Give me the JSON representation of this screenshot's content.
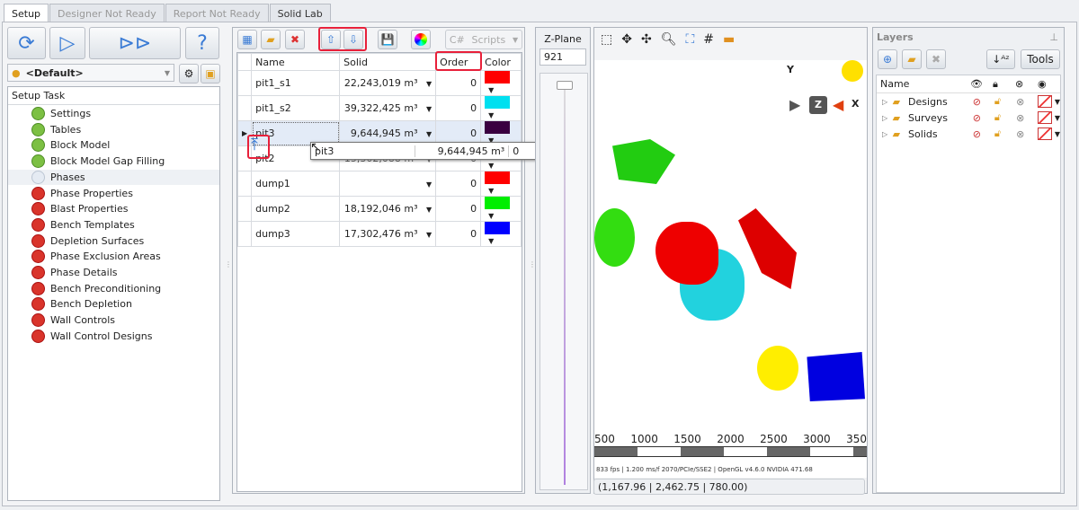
{
  "tabs": [
    "Setup",
    "Designer Not Ready",
    "Report Not Ready",
    "Solid Lab"
  ],
  "profile": "<Default>",
  "setup_task_header": "Setup Task",
  "tasks": [
    {
      "label": "Settings",
      "status": "ok"
    },
    {
      "label": "Tables",
      "status": "ok"
    },
    {
      "label": "Block Model",
      "status": "ok"
    },
    {
      "label": "Block Model Gap Filling",
      "status": "ok"
    },
    {
      "label": "Phases",
      "status": "pending"
    },
    {
      "label": "Phase Properties",
      "status": "error"
    },
    {
      "label": "Blast Properties",
      "status": "error"
    },
    {
      "label": "Bench Templates",
      "status": "error"
    },
    {
      "label": "Depletion Surfaces",
      "status": "error"
    },
    {
      "label": "Phase Exclusion Areas",
      "status": "error"
    },
    {
      "label": "Phase Details",
      "status": "error"
    },
    {
      "label": "Bench Preconditioning",
      "status": "error"
    },
    {
      "label": "Bench Depletion",
      "status": "error"
    },
    {
      "label": "Wall Controls",
      "status": "error"
    },
    {
      "label": "Wall Control Designs",
      "status": "error"
    }
  ],
  "grid": {
    "scripts_label": "Scripts",
    "columns": [
      "Name",
      "Solid",
      "Order",
      "Color"
    ],
    "rows": [
      {
        "name": "pit1_s1",
        "solid": "22,243,019 m³",
        "order": "0",
        "color": "#ff0000"
      },
      {
        "name": "pit1_s2",
        "solid": "39,322,425 m³",
        "order": "0",
        "color": "#00e0f0"
      },
      {
        "name": "pit3",
        "solid": "9,644,945 m³",
        "order": "0",
        "color": "#3a0040"
      },
      {
        "name": "pit2",
        "solid": "15,302,088 m³",
        "order": "0",
        "color": "#33ee22"
      },
      {
        "name": "dump1",
        "solid": "",
        "order": "0",
        "color": "#ff0000"
      },
      {
        "name": "dump2",
        "solid": "18,192,046 m³",
        "order": "0",
        "color": "#00ee00"
      },
      {
        "name": "dump3",
        "solid": "17,302,476 m³",
        "order": "0",
        "color": "#0000ff"
      }
    ],
    "drag_ghost": {
      "name": "pit3",
      "solid": "9,644,945 m³",
      "order": "0",
      "color": "#3a0040"
    }
  },
  "zplane": {
    "label": "Z-Plane",
    "value": "921"
  },
  "viewer": {
    "scale_labels": [
      "500",
      "1000",
      "1500",
      "2000",
      "2500",
      "3000",
      "350"
    ],
    "status": "833 fps | 1.200 ms/f 2070/PCIe/SSE2 | OpenGL v4.6.0 NVIDIA 471.68",
    "coords": "(1,167.96 | 2,462.75 | 780.00)",
    "axes": {
      "y": "Y",
      "x": "X",
      "z": "Z"
    }
  },
  "layers": {
    "title": "Layers",
    "tools_label": "Tools",
    "name_header": "Name",
    "items": [
      "Designs",
      "Surveys",
      "Solids"
    ]
  }
}
